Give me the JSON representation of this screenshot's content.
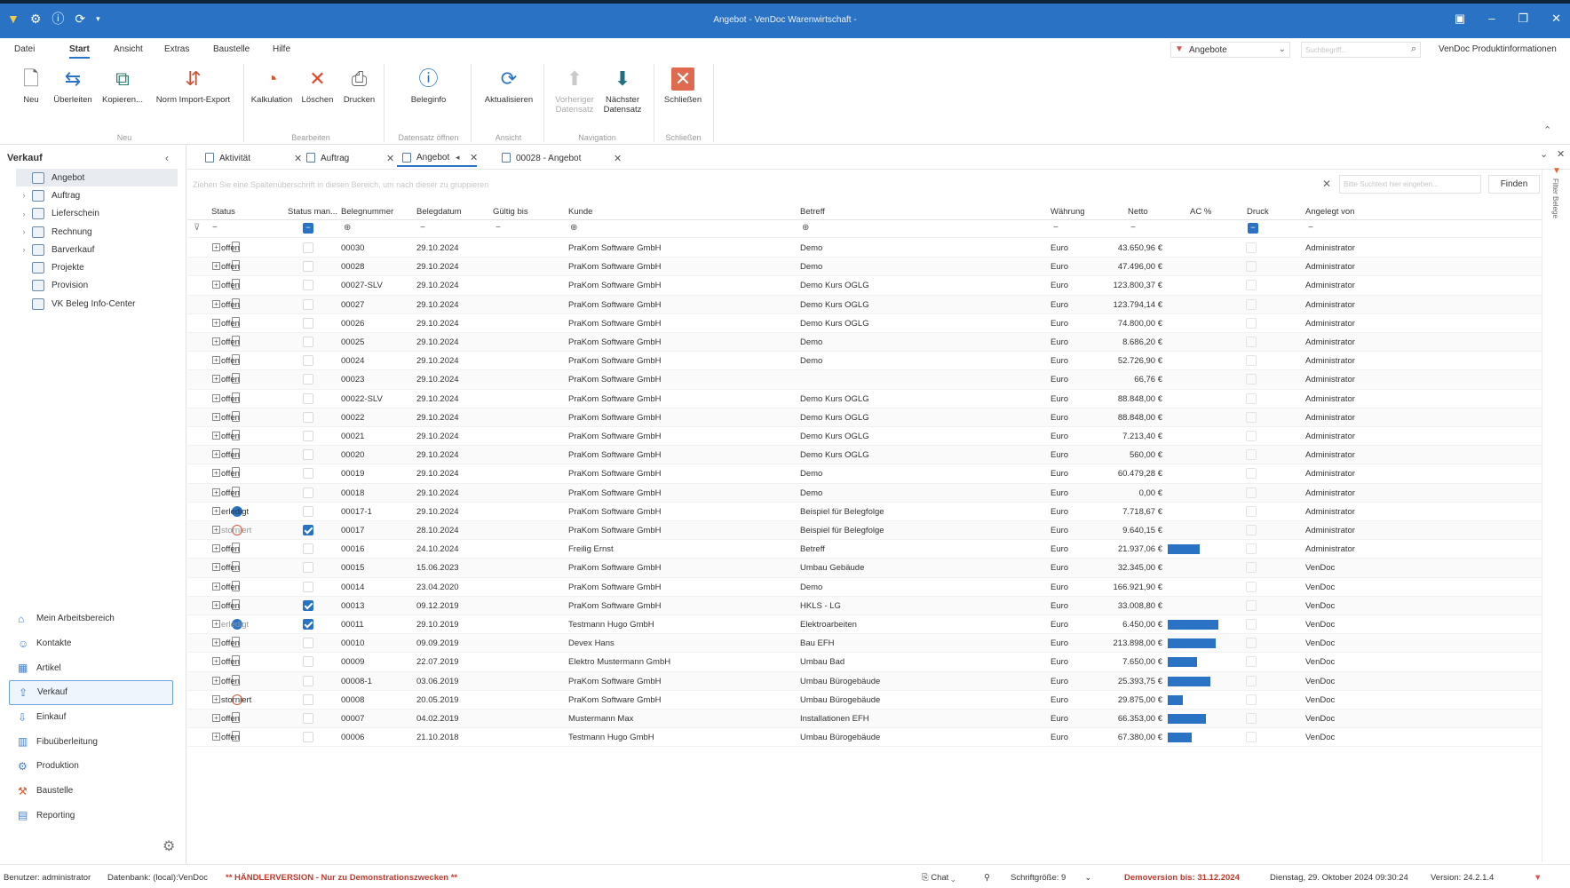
{
  "window": {
    "title": "Angebot - VenDoc Warenwirtschaft -"
  },
  "menu": {
    "items": [
      "Datei",
      "Start",
      "Ansicht",
      "Extras",
      "Baustelle",
      "Hilfe"
    ]
  },
  "topbar": {
    "dropdown_value": "Angebote",
    "search_placeholder": "Suchbegriff...",
    "info_link": "VenDoc Produktinformationen"
  },
  "ribbon": {
    "buttons": {
      "neu": "Neu",
      "ueberleiten": "Überleiten",
      "kopieren": "Kopieren...",
      "import": "Norm Import-Export",
      "kalkulation": "Kalkulation",
      "loeschen": "Löschen",
      "drucken": "Drucken",
      "beleginfo": "Beleginfo",
      "aktualisieren": "Aktualisieren",
      "vorheriger1": "Vorheriger",
      "vorheriger2": "Datensatz",
      "naechster1": "Nächster",
      "naechster2": "Datensatz",
      "schliessen": "Schließen"
    },
    "groups": {
      "neu": "Neu",
      "bearbeiten": "Bearbeiten",
      "datensatz": "Datensatz öffnen",
      "ansicht": "Ansicht",
      "navigation": "Navigation",
      "schliessen": "Schließen"
    }
  },
  "sidebar": {
    "title": "Verkauf",
    "tree": [
      "Angebot",
      "Auftrag",
      "Lieferschein",
      "Rechnung",
      "Barverkauf",
      "Projekte",
      "Provision",
      "VK Beleg Info-Center"
    ],
    "nav": [
      "Mein Arbeitsbereich",
      "Kontakte",
      "Artikel",
      "Verkauf",
      "Einkauf",
      "Fibuüberleitung",
      "Produktion",
      "Baustelle",
      "Reporting"
    ]
  },
  "tabs": [
    "Aktivität",
    "Auftrag",
    "Angebot",
    "00028 - Angebot"
  ],
  "toolbar": {
    "group_hint": "Ziehen Sie eine Spaltenüberschrift in diesen Bereich, um nach dieser zu gruppieren",
    "find_placeholder": "Bitte Suchtext hier eingeben...",
    "find_button": "Finden",
    "filter_panel": "Filter Belege"
  },
  "grid": {
    "columns": [
      "Status",
      "Status man...",
      "Belegnummer",
      "Belegdatum",
      "Gültig bis",
      "Kunde",
      "Betreff",
      "Währung",
      "Netto",
      "AC %",
      "Druck",
      "Angelegt von"
    ],
    "rows": [
      {
        "status": "offen",
        "icon": "doc",
        "man": false,
        "nr": "00030",
        "datum": "29.10.2024",
        "kunde": "PraKom Software GmbH",
        "betreff": "Demo",
        "waehrung": "Euro",
        "netto": "43.650,96 €",
        "ac": 0,
        "von": "Administrator"
      },
      {
        "status": "offen",
        "icon": "doc",
        "man": false,
        "nr": "00028",
        "datum": "29.10.2024",
        "kunde": "PraKom Software GmbH",
        "betreff": "Demo",
        "waehrung": "Euro",
        "netto": "47.496,00 €",
        "ac": 0,
        "von": "Administrator"
      },
      {
        "status": "offen",
        "icon": "doc",
        "man": false,
        "nr": "00027-SLV",
        "datum": "29.10.2024",
        "kunde": "PraKom Software GmbH",
        "betreff": "Demo Kurs OGLG",
        "waehrung": "Euro",
        "netto": "123.800,37 €",
        "ac": 0,
        "von": "Administrator"
      },
      {
        "status": "offen",
        "icon": "doc",
        "man": false,
        "nr": "00027",
        "datum": "29.10.2024",
        "kunde": "PraKom Software GmbH",
        "betreff": "Demo Kurs OGLG",
        "waehrung": "Euro",
        "netto": "123.794,14 €",
        "ac": 0,
        "von": "Administrator"
      },
      {
        "status": "offen",
        "icon": "doc",
        "man": false,
        "nr": "00026",
        "datum": "29.10.2024",
        "kunde": "PraKom Software GmbH",
        "betreff": "Demo Kurs OGLG",
        "waehrung": "Euro",
        "netto": "74.800,00 €",
        "ac": 0,
        "von": "Administrator"
      },
      {
        "status": "offen",
        "icon": "doc",
        "man": false,
        "nr": "00025",
        "datum": "29.10.2024",
        "kunde": "PraKom Software GmbH",
        "betreff": "Demo",
        "waehrung": "Euro",
        "netto": "8.686,20 €",
        "ac": 0,
        "von": "Administrator"
      },
      {
        "status": "offen",
        "icon": "doc",
        "man": false,
        "nr": "00024",
        "datum": "29.10.2024",
        "kunde": "PraKom Software GmbH",
        "betreff": "Demo",
        "waehrung": "Euro",
        "netto": "52.726,90 €",
        "ac": 0,
        "von": "Administrator"
      },
      {
        "status": "offen",
        "icon": "doc",
        "man": false,
        "nr": "00023",
        "datum": "29.10.2024",
        "kunde": "PraKom Software GmbH",
        "betreff": "",
        "waehrung": "Euro",
        "netto": "66,76 €",
        "ac": 0,
        "von": "Administrator"
      },
      {
        "status": "offen",
        "icon": "doc",
        "man": false,
        "nr": "00022-SLV",
        "datum": "29.10.2024",
        "kunde": "PraKom Software GmbH",
        "betreff": "Demo Kurs OGLG",
        "waehrung": "Euro",
        "netto": "88.848,00 €",
        "ac": 0,
        "von": "Administrator"
      },
      {
        "status": "offen",
        "icon": "doc",
        "man": false,
        "nr": "00022",
        "datum": "29.10.2024",
        "kunde": "PraKom Software GmbH",
        "betreff": "Demo Kurs OGLG",
        "waehrung": "Euro",
        "netto": "88.848,00 €",
        "ac": 0,
        "von": "Administrator"
      },
      {
        "status": "offen",
        "icon": "doc",
        "man": false,
        "nr": "00021",
        "datum": "29.10.2024",
        "kunde": "PraKom Software GmbH",
        "betreff": "Demo Kurs OGLG",
        "waehrung": "Euro",
        "netto": "7.213,40 €",
        "ac": 0,
        "von": "Administrator"
      },
      {
        "status": "offen",
        "icon": "doc",
        "man": false,
        "nr": "00020",
        "datum": "29.10.2024",
        "kunde": "PraKom Software GmbH",
        "betreff": "Demo Kurs OGLG",
        "waehrung": "Euro",
        "netto": "560,00 €",
        "ac": 0,
        "von": "Administrator"
      },
      {
        "status": "offen",
        "icon": "doc",
        "man": false,
        "nr": "00019",
        "datum": "29.10.2024",
        "kunde": "PraKom Software GmbH",
        "betreff": "Demo",
        "waehrung": "Euro",
        "netto": "60.479,28 €",
        "ac": 0,
        "von": "Administrator"
      },
      {
        "status": "offen",
        "icon": "doc",
        "man": false,
        "nr": "00018",
        "datum": "29.10.2024",
        "kunde": "PraKom Software GmbH",
        "betreff": "Demo",
        "waehrung": "Euro",
        "netto": "0,00 €",
        "ac": 0,
        "von": "Administrator"
      },
      {
        "status": "erledigt",
        "icon": "ok",
        "man": false,
        "nr": "00017-1",
        "datum": "29.10.2024",
        "kunde": "PraKom Software GmbH",
        "betreff": "Beispiel für Belegfolge",
        "waehrung": "Euro",
        "netto": "7.718,67 €",
        "ac": 0,
        "von": "Administrator"
      },
      {
        "status": "storniert",
        "icon": "st",
        "man": true,
        "nr": "00017",
        "datum": "28.10.2024",
        "kunde": "PraKom Software GmbH",
        "betreff": "Beispiel für Belegfolge",
        "waehrung": "Euro",
        "netto": "9.640,15 €",
        "ac": 0,
        "von": "Administrator"
      },
      {
        "status": "offen",
        "icon": "doc",
        "man": false,
        "nr": "00016",
        "datum": "24.10.2024",
        "kunde": "Freilig Ernst",
        "betreff": "Betreff",
        "waehrung": "Euro",
        "netto": "21.937,06 €",
        "ac": 0.6,
        "von": "Administrator"
      },
      {
        "status": "offen",
        "icon": "doc",
        "man": false,
        "nr": "00015",
        "datum": "15.06.2023",
        "kunde": "PraKom Software GmbH",
        "betreff": "Umbau Gebäude",
        "waehrung": "Euro",
        "netto": "32.345,00 €",
        "ac": 0,
        "von": "VenDoc"
      },
      {
        "status": "offen",
        "icon": "doc",
        "man": false,
        "nr": "00014",
        "datum": "23.04.2020",
        "kunde": "PraKom Software GmbH",
        "betreff": "Demo",
        "waehrung": "Euro",
        "netto": "166.921,90 €",
        "ac": 0,
        "von": "VenDoc"
      },
      {
        "status": "offen",
        "icon": "doc",
        "man": true,
        "nr": "00013",
        "datum": "09.12.2019",
        "kunde": "PraKom Software GmbH",
        "betreff": "HKLS - LG",
        "waehrung": "Euro",
        "netto": "33.008,80 €",
        "ac": 0,
        "von": "VenDoc"
      },
      {
        "status": "erledigt",
        "icon": "ok",
        "man": true,
        "nr": "00011",
        "datum": "29.10.2019",
        "kunde": "Testmann Hugo GmbH",
        "betreff": "Elektroarbeiten",
        "waehrung": "Euro",
        "netto": "6.450,00 €",
        "ac": 0.95,
        "von": "VenDoc"
      },
      {
        "status": "offen",
        "icon": "doc",
        "man": false,
        "nr": "00010",
        "datum": "09.09.2019",
        "kunde": "Devex Hans",
        "betreff": "Bau EFH",
        "waehrung": "Euro",
        "netto": "213.898,00 €",
        "ac": 0.9,
        "von": "VenDoc"
      },
      {
        "status": "offen",
        "icon": "doc",
        "man": false,
        "nr": "00009",
        "datum": "22.07.2019",
        "kunde": "Elektro Mustermann GmbH",
        "betreff": "Umbau Bad",
        "waehrung": "Euro",
        "netto": "7.650,00 €",
        "ac": 0.55,
        "von": "VenDoc"
      },
      {
        "status": "offen",
        "icon": "doc",
        "man": false,
        "nr": "00008-1",
        "datum": "03.06.2019",
        "kunde": "PraKom Software GmbH",
        "betreff": "Umbau Bürogebäude",
        "waehrung": "Euro",
        "netto": "25.393,75 €",
        "ac": 0.8,
        "von": "VenDoc"
      },
      {
        "status": "storniert",
        "icon": "st",
        "man": false,
        "nr": "00008",
        "datum": "20.05.2019",
        "kunde": "PraKom Software GmbH",
        "betreff": "Umbau Bürogebäude",
        "waehrung": "Euro",
        "netto": "29.875,00 €",
        "ac": 0.28,
        "von": "VenDoc"
      },
      {
        "status": "offen",
        "icon": "doc",
        "man": false,
        "nr": "00007",
        "datum": "04.02.2019",
        "kunde": "Mustermann Max",
        "betreff": "Installationen EFH",
        "waehrung": "Euro",
        "netto": "66.353,00 €",
        "ac": 0.72,
        "von": "VenDoc"
      },
      {
        "status": "offen",
        "icon": "doc",
        "man": false,
        "nr": "00006",
        "datum": "21.10.2018",
        "kunde": "Testmann Hugo GmbH",
        "betreff": "Umbau Bürogebäude",
        "waehrung": "Euro",
        "netto": "67.380,00 €",
        "ac": 0.45,
        "von": "VenDoc"
      }
    ]
  },
  "statusbar": {
    "benutzer": "Benutzer: administrator",
    "datenbank": "Datenbank: (local):VenDoc",
    "haendler": "** HÄNDLERVERSION - Nur zu Demonstrationszwecken **",
    "chat": "Chat",
    "schriftgroesse": "Schriftgröße: 9",
    "demo": "Demoversion bis: 31.12.2024",
    "datum": "Dienstag, 29. Oktober 2024 09:30:24",
    "version": "Version: 24.2.1.4"
  },
  "colors": {
    "accent": "#2a73c4",
    "title_bar": "#2a73c4",
    "warning": "#c0392b"
  }
}
